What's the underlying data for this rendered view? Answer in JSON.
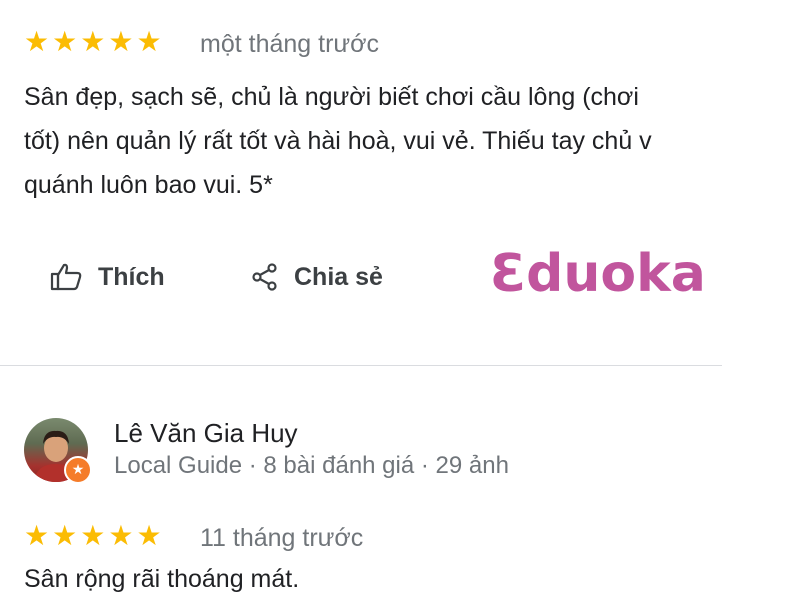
{
  "review1": {
    "stars": [
      "★",
      "★",
      "★",
      "★",
      "★"
    ],
    "time": "một tháng trước",
    "text_lines": [
      "Sân đẹp, sạch sẽ, chủ là người biết chơi cầu lông (chơi",
      "tốt) nên quản lý rất tốt và hài hoà, vui vẻ. Thiếu tay chủ v",
      "quánh luôn bao vui. 5*"
    ],
    "actions": {
      "like_label": "Thích",
      "share_label": "Chia sẻ"
    }
  },
  "watermark": "Ɛduoka",
  "review2": {
    "reviewer_name": "Lê Văn Gia Huy",
    "reviewer_meta": "Local Guide · 8 bài đánh giá · 29 ảnh",
    "badge_icon": "★",
    "stars": [
      "★",
      "★",
      "★",
      "★",
      "★"
    ],
    "time": "11 tháng trước",
    "text": "Sân rộng rãi thoáng mát."
  },
  "colors": {
    "star": "#fbbc04",
    "watermark": "#c1559d",
    "local_guide_badge": "#f57c2a"
  }
}
